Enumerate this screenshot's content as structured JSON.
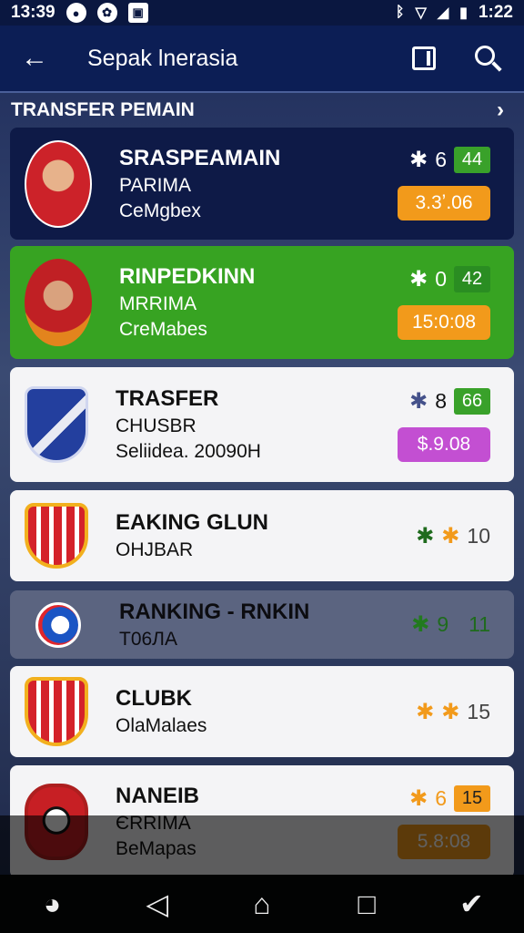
{
  "status_bar": {
    "time_left": "13:39",
    "time_right": "1:22",
    "icons_left": [
      "record-icon",
      "app-icon",
      "gallery-icon"
    ],
    "icons_right": [
      "bluetooth-icon",
      "wifi-icon",
      "signal-icon",
      "battery-icon"
    ]
  },
  "app_bar": {
    "title": "Sepak lnerasia",
    "back_glyph": "←"
  },
  "section": {
    "title": "TRANSFER PEMAIN",
    "chevron": "›"
  },
  "cards": [
    {
      "title": "SRASPEAMAIN",
      "line1": "PARIMA",
      "line2": "CeMgbex",
      "stat_num": "6",
      "score": "44",
      "chip": "3.3ʼ.06",
      "chip_color": "#f29a1b",
      "style": "navy",
      "crest": "player"
    },
    {
      "title": "RINPEDKINN",
      "line1": "MRRIMA",
      "line2": "CreMabes",
      "stat_num": "0",
      "score": "42",
      "chip": "15:0:08",
      "chip_color": "#f29a1b",
      "style": "green",
      "crest": "player2"
    },
    {
      "title": "TRASFER",
      "line1": "CHUSBR",
      "line2": "Seliidea. 20090Н",
      "stat_num": "8",
      "score": "66",
      "chip": "$.9.08",
      "chip_color": "#c34fd2",
      "style": "white",
      "crest": "crest-blue"
    },
    {
      "title": "EAKING GLUN",
      "line1": "OHJBAR",
      "line2": "",
      "stat_num": "10",
      "score": "",
      "chip": "",
      "style": "white",
      "crest": "crest-red"
    },
    {
      "title": "RANKING - RNKIN",
      "line1": "T06ЛA",
      "line2": "",
      "stat_num": "9",
      "stat_num2": "11",
      "score": "",
      "chip": "",
      "style": "gray",
      "crest": "crest-circle"
    },
    {
      "title": "CLUBK",
      "line1": "OlaMalaes",
      "line2": "",
      "stat_num": "15",
      "score": "",
      "chip": "",
      "style": "white",
      "crest": "crest-red"
    },
    {
      "title": "NANEIB",
      "line1": "ЄRRIMA",
      "line2": "BeMapas",
      "stat_num": "6",
      "score": "15",
      "chip": "5.8:08",
      "chip_color": "#f29a1b",
      "style": "white",
      "crest": "crest-ball"
    }
  ],
  "nav_bar": {
    "items": [
      "app-icon",
      "back-icon",
      "home-icon",
      "recents-icon",
      "assistant-icon"
    ]
  }
}
